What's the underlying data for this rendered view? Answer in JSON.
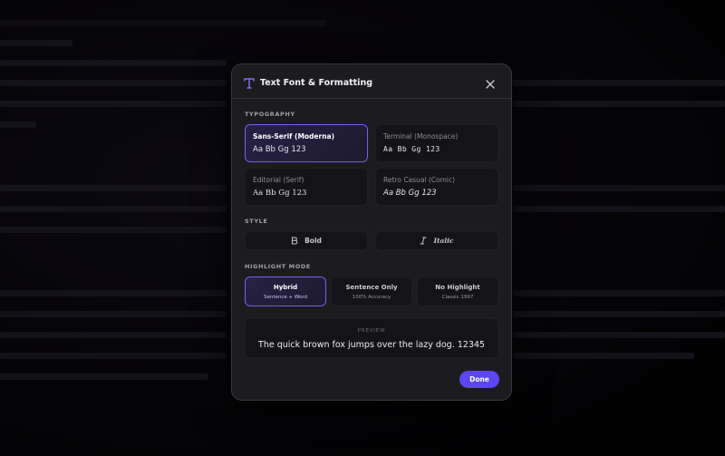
{
  "dialog": {
    "title": "Text Font & Formatting",
    "title_icon": "text-t-icon",
    "close_icon": "close-icon"
  },
  "typography": {
    "label": "TYPOGRAPHY",
    "options": [
      {
        "name": "Sans-Serif (Moderna)",
        "sample": "Aa Bb Gg 123",
        "selected": true
      },
      {
        "name": "Terminal (Monospace)",
        "sample": "Aa Bb Gg 123",
        "selected": false
      },
      {
        "name": "Editorial (Serif)",
        "sample": "Aa Bb Gg 123",
        "selected": false
      },
      {
        "name": "Retro Casual (Comic)",
        "sample": "Aa Bb Gg 123",
        "selected": false
      }
    ]
  },
  "style": {
    "label": "STYLE",
    "bold": {
      "label": "Bold",
      "icon": "bold-icon"
    },
    "italic": {
      "label": "Italic",
      "icon": "italic-icon"
    }
  },
  "highlight": {
    "label": "HIGHLIGHT MODE",
    "options": [
      {
        "title": "Hybrid",
        "subtitle": "Sentence + Word",
        "selected": true
      },
      {
        "title": "Sentence Only",
        "subtitle": "100% Accuracy",
        "selected": false
      },
      {
        "title": "No Highlight",
        "subtitle": "Classic 1997",
        "selected": false
      }
    ]
  },
  "preview": {
    "label": "PREVIEW",
    "text": "The quick brown fox jumps over the lazy dog. 12345"
  },
  "actions": {
    "done_label": "Done"
  },
  "colors": {
    "accent": "#5b46f2",
    "selected_border": "#6d62ee",
    "modal_bg": "#1c1c1e",
    "card_bg": "#141416"
  }
}
